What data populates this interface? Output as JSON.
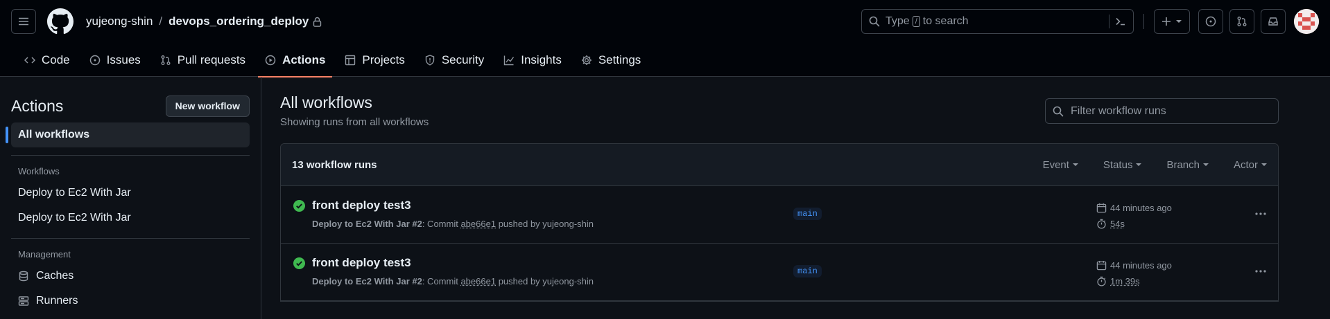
{
  "header": {
    "owner": "yujeong-shin",
    "separator": "/",
    "repo": "devops_ordering_deploy",
    "search": {
      "prefix": "Type",
      "slash": "/",
      "suffix": "to search"
    }
  },
  "tabs": [
    {
      "label": "Code",
      "icon": "code-icon"
    },
    {
      "label": "Issues",
      "icon": "issue-icon"
    },
    {
      "label": "Pull requests",
      "icon": "pull-request-icon"
    },
    {
      "label": "Actions",
      "icon": "play-icon",
      "active": true
    },
    {
      "label": "Projects",
      "icon": "table-icon"
    },
    {
      "label": "Security",
      "icon": "shield-icon"
    },
    {
      "label": "Insights",
      "icon": "graph-icon"
    },
    {
      "label": "Settings",
      "icon": "gear-icon"
    }
  ],
  "sidebar": {
    "title": "Actions",
    "new_workflow": "New workflow",
    "all_workflows": "All workflows",
    "workflows_section": "Workflows",
    "workflows": [
      "Deploy to Ec2 With Jar",
      "Deploy to Ec2 With Jar"
    ],
    "management_section": "Management",
    "management": [
      {
        "label": "Caches",
        "icon": "database-icon"
      },
      {
        "label": "Runners",
        "icon": "server-icon"
      }
    ]
  },
  "main": {
    "title": "All workflows",
    "subtitle": "Showing runs from all workflows",
    "filter_placeholder": "Filter workflow runs",
    "count": "13 workflow runs",
    "filters": [
      "Event",
      "Status",
      "Branch",
      "Actor"
    ],
    "runs": [
      {
        "title": "front deploy test3",
        "workflow": "Deploy to Ec2 With Jar #2",
        "commit_prefix": ": Commit ",
        "sha": "abe66e1",
        "pushed_by": " pushed by yujeong-shin",
        "branch": "main",
        "time": "44 minutes ago",
        "duration": "54s",
        "status": "success"
      },
      {
        "title": "front deploy test3",
        "workflow": "Deploy to Ec2 With Jar #2",
        "commit_prefix": ": Commit ",
        "sha": "abe66e1",
        "pushed_by": " pushed by yujeong-shin",
        "branch": "main",
        "time": "44 minutes ago",
        "duration": "1m 39s",
        "status": "success"
      }
    ]
  },
  "colors": {
    "accent": "#f78166",
    "success": "#3fb950",
    "link": "#4493f8"
  }
}
